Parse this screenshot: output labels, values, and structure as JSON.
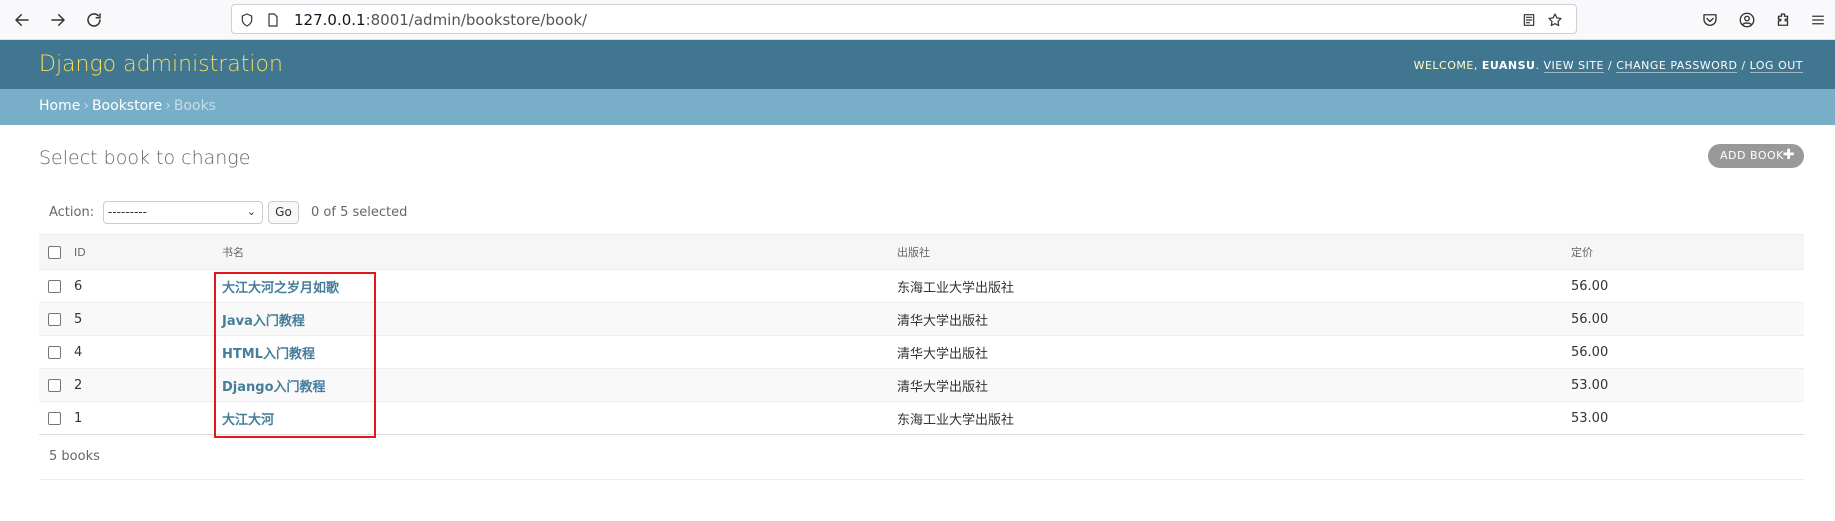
{
  "browser": {
    "url_host": "127.0.0.1",
    "url_rest": ":8001/admin/bookstore/book/"
  },
  "header": {
    "branding": "Django administration",
    "welcome": "WELCOME,",
    "username": "EUANSU",
    "view_site": "VIEW SITE",
    "change_password": "CHANGE PASSWORD",
    "log_out": "LOG OUT"
  },
  "breadcrumbs": {
    "home": "Home",
    "app": "Bookstore",
    "current": "Books"
  },
  "main": {
    "title": "Select book to change",
    "add_button": "ADD BOOK",
    "action_label": "Action:",
    "action_selected": "---------",
    "go_button": "Go",
    "counter": "0 of 5 selected",
    "paginator": "5 books"
  },
  "table": {
    "columns": [
      "ID",
      "书名",
      "出版社",
      "定价"
    ],
    "rows": [
      {
        "id": "6",
        "title": "大江大河之岁月如歌",
        "publisher": "东海工业大学出版社",
        "price": "56.00"
      },
      {
        "id": "5",
        "title": "Java入门教程",
        "publisher": "清华大学出版社",
        "price": "56.00"
      },
      {
        "id": "4",
        "title": "HTML入门教程",
        "publisher": "清华大学出版社",
        "price": "56.00"
      },
      {
        "id": "2",
        "title": "Django入门教程",
        "publisher": "清华大学出版社",
        "price": "53.00"
      },
      {
        "id": "1",
        "title": "大江大河",
        "publisher": "东海工业大学出版社",
        "price": "53.00"
      }
    ]
  },
  "colors": {
    "header_bg": "#417690",
    "breadcrumb_bg": "#79aec8",
    "branding": "#f5dd5d",
    "link": "#447e9b",
    "highlight": "#e3181f"
  }
}
